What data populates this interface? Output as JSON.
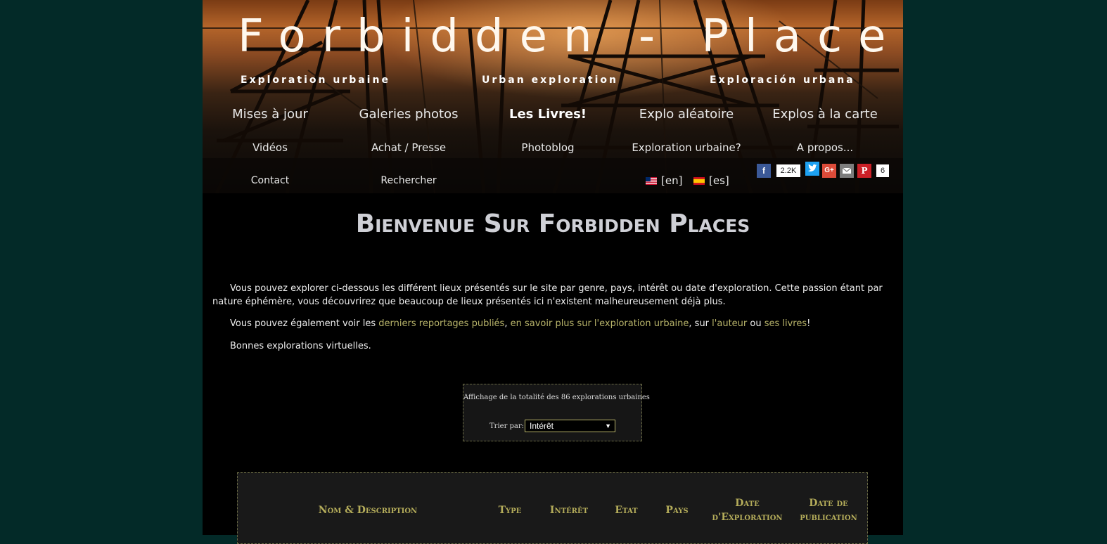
{
  "site": {
    "title": "Forbidden - Places",
    "taglines": [
      "Exploration urbaine",
      "Urban exploration",
      "Exploración urbana"
    ]
  },
  "nav": {
    "row1": [
      "Mises à jour",
      "Galeries photos",
      "Les Livres!",
      "Explo aléatoire",
      "Explos à la carte"
    ],
    "row2": [
      "Vidéos",
      "Achat / Presse",
      "Photoblog",
      "Exploration urbaine?",
      "A propos..."
    ],
    "row3": [
      "Contact",
      "Rechercher"
    ]
  },
  "languages": [
    {
      "label": "[en]",
      "flag": "us-flag-icon"
    },
    {
      "label": "[es]",
      "flag": "spain-flag-icon"
    }
  ],
  "social": {
    "facebook_count": "2.2K",
    "pinterest_count": "6",
    "colors": {
      "facebook": "#3b5998",
      "twitter": "#1da1f2",
      "googleplus": "#dd4b39",
      "email": "#7d7d7d",
      "pinterest": "#cb2027"
    }
  },
  "main": {
    "heading": "Bienvenue Sur Forbidden Places",
    "intro": "Vous pouvez explorer ci-dessous les différent lieux présentés sur le site par genre, pays, intérêt ou date d'exploration. Cette passion étant par nature éphémère, vous découvrirez que beaucoup de lieux présentés ici n'existent malheureusement déjà plus.",
    "links_sentence": {
      "prefix": "Vous pouvez également voir les ",
      "link1": "derniers reportages publiés",
      "sep1": ", ",
      "link2": "en savoir plus sur l'exploration urbaine",
      "sep2": ", sur ",
      "link3": "l'auteur",
      "sep3": " ou ",
      "link4": "ses livres",
      "suffix": "!"
    },
    "closing": "Bonnes explorations virtuelles."
  },
  "sort": {
    "info": "Affichage de la totalité des 86 explorations urbaines",
    "label": "Trier par:",
    "selected": "Intérêt"
  },
  "table": {
    "headers": {
      "name": "Nom & Description",
      "type": "Type",
      "interest": "Intérêt",
      "state": "Etat",
      "country": "Pays",
      "explo_date_1": "Date",
      "explo_date_2": "d'Exploration",
      "pub_date_1": "Date de",
      "pub_date_2": "publication"
    }
  },
  "colors": {
    "background": "#032a28",
    "link": "#b8b46a",
    "table_header": "#b4ac5a"
  }
}
